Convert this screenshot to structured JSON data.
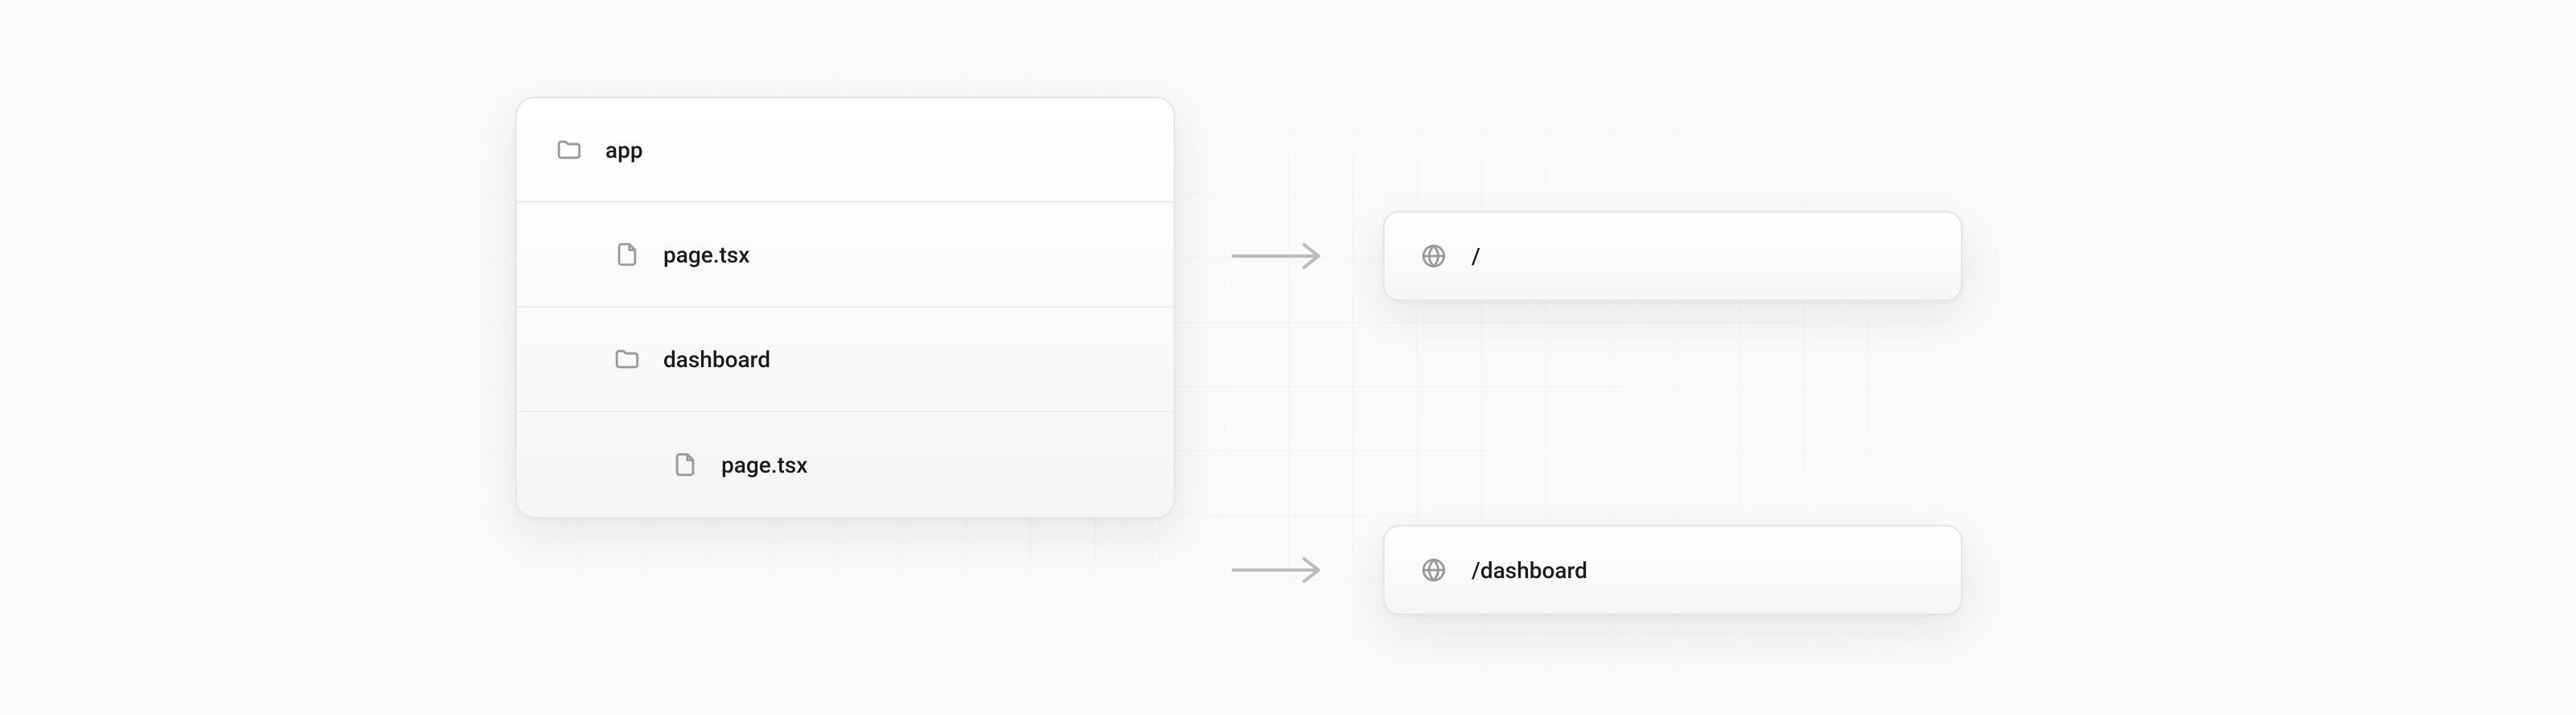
{
  "tree": {
    "root": {
      "label": "app",
      "icon": "folder"
    },
    "level1_file": {
      "label": "page.tsx",
      "icon": "file"
    },
    "level1_folder": {
      "label": "dashboard",
      "icon": "folder"
    },
    "level2_file": {
      "label": "page.tsx",
      "icon": "file"
    }
  },
  "routes": {
    "root": {
      "path": "/",
      "icon": "globe"
    },
    "dashboard": {
      "path": "/dashboard",
      "icon": "globe"
    }
  }
}
